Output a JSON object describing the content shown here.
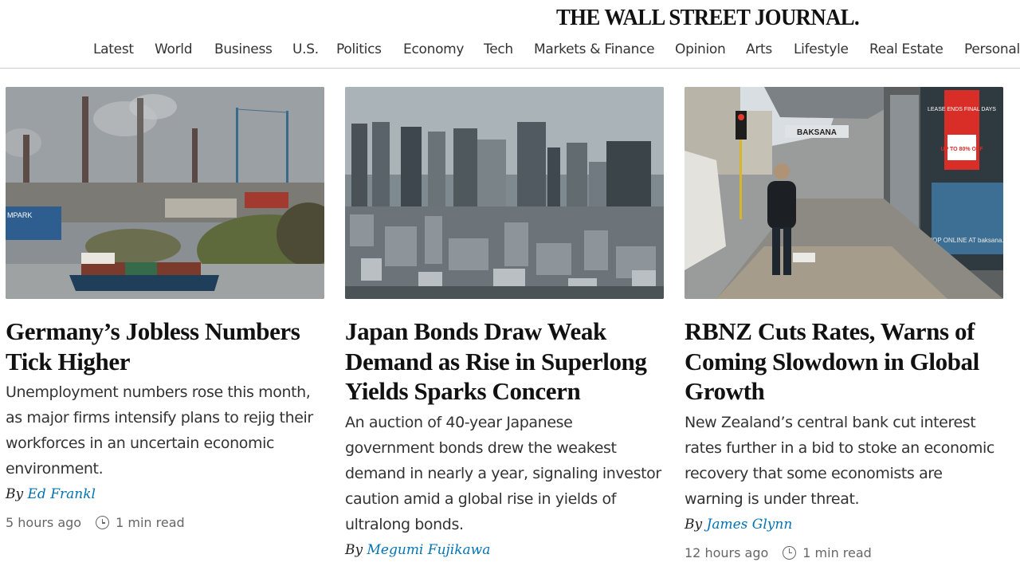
{
  "masthead": {
    "logo": "THE WALL STREET JOURNAL."
  },
  "nav": {
    "items": [
      "Latest",
      "World",
      "Business",
      "U.S.",
      "Politics",
      "Economy",
      "Tech",
      "Markets & Finance",
      "Opinion",
      "Arts",
      "Lifestyle",
      "Real Estate",
      "Personal"
    ]
  },
  "articles": [
    {
      "headline": "Germany’s Jobless Numbers Tick Higher",
      "summary": "Unemployment numbers rose this month, as major firms intensify plans to rejig their workforces in an uncertain economic environment.",
      "by": "By",
      "author": "Ed Frankl",
      "time": "5 hours ago",
      "read": "1 min read"
    },
    {
      "headline": "Japan Bonds Draw Weak Demand as Rise in Superlong Yields Sparks Concern",
      "summary": "An auction of 40-year Japanese government bonds drew the weakest demand in nearly a year, signaling investor caution amid a global rise in yields of ultralong bonds.",
      "by": "By",
      "author": "Megumi Fujikawa",
      "time": "",
      "read": ""
    },
    {
      "headline": "RBNZ Cuts Rates, Warns of Coming Slowdown in Global Growth",
      "summary": "New Zealand’s central bank cut interest rates further in a bid to stoke an economic recovery that some economists are warning is under threat.",
      "by": "By",
      "author": "James Glynn",
      "time": "12 hours ago",
      "read": "1 min read"
    }
  ],
  "images": {
    "img1_sign": "MPARK",
    "img3_street_sign": "BAKSANA",
    "img3_poster_top": "LEASE ENDS FINAL DAYS",
    "img3_poster_mid": "UP TO 80% OFF",
    "img3_window_text": "SHOP ONLINE AT baksana.co.nz"
  }
}
